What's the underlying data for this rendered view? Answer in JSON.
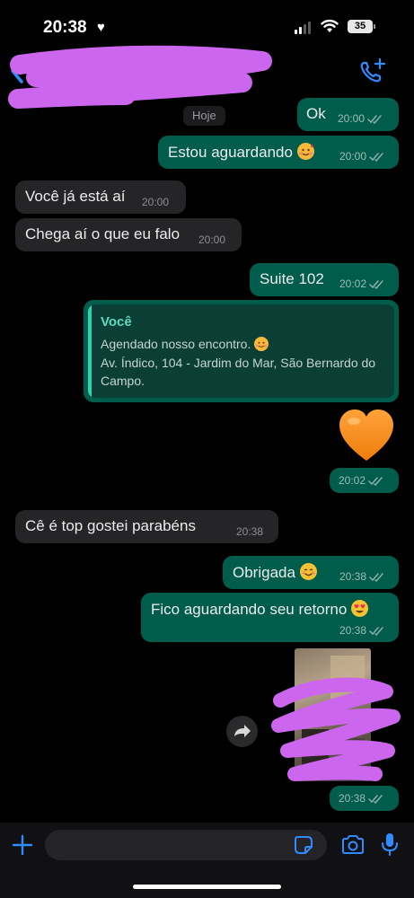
{
  "status_bar": {
    "time": "20:38",
    "battery": "35"
  },
  "chat": {
    "day_label": "Hoje",
    "messages": [
      {
        "direction": "out",
        "text": "Ok",
        "time": "20:00"
      },
      {
        "direction": "out",
        "text": "Estou aguardando",
        "emoji": "smiling-face-with-hearts",
        "time": "20:00"
      },
      {
        "direction": "in",
        "text": "Você já está aí",
        "time": "20:00"
      },
      {
        "direction": "in",
        "text": "Chega aí o que eu falo",
        "time": "20:00"
      },
      {
        "direction": "out",
        "text": "Suite 102",
        "time": "20:02"
      },
      {
        "direction": "out",
        "type": "quote",
        "sender": "Você",
        "line1": "Agendado nosso encontro.",
        "line2": "Av. Índico, 104 - Jardim do Mar, São Bernardo do",
        "line3": "Campo."
      },
      {
        "direction": "out",
        "type": "emoji",
        "emoji": "orange-heart",
        "time": "20:02"
      },
      {
        "direction": "in",
        "text": "Cê é top gostei parabéns",
        "time": "20:38"
      },
      {
        "direction": "out",
        "text": "Obrigada",
        "emoji": "smiling-face",
        "time": "20:38"
      },
      {
        "direction": "out",
        "text": "Fico aguardando seu retorno",
        "emoji": "heart-eyes-face",
        "time": "20:38"
      },
      {
        "direction": "out",
        "type": "image",
        "time": "20:38"
      }
    ]
  },
  "icons": {
    "back": "chevron-left-icon",
    "call": "phone-plus-icon",
    "forward": "forward-arrow-icon",
    "plus": "plus-icon",
    "sticker": "sticker-icon",
    "camera": "camera-icon",
    "mic": "microphone-icon"
  },
  "colors": {
    "background": "#000000",
    "outgoing_bubble": "#005c4b",
    "incoming_bubble": "#252527",
    "accent": "#2f8cff",
    "quote_accent": "#2fd3ae",
    "redaction": "#cc66ee"
  }
}
